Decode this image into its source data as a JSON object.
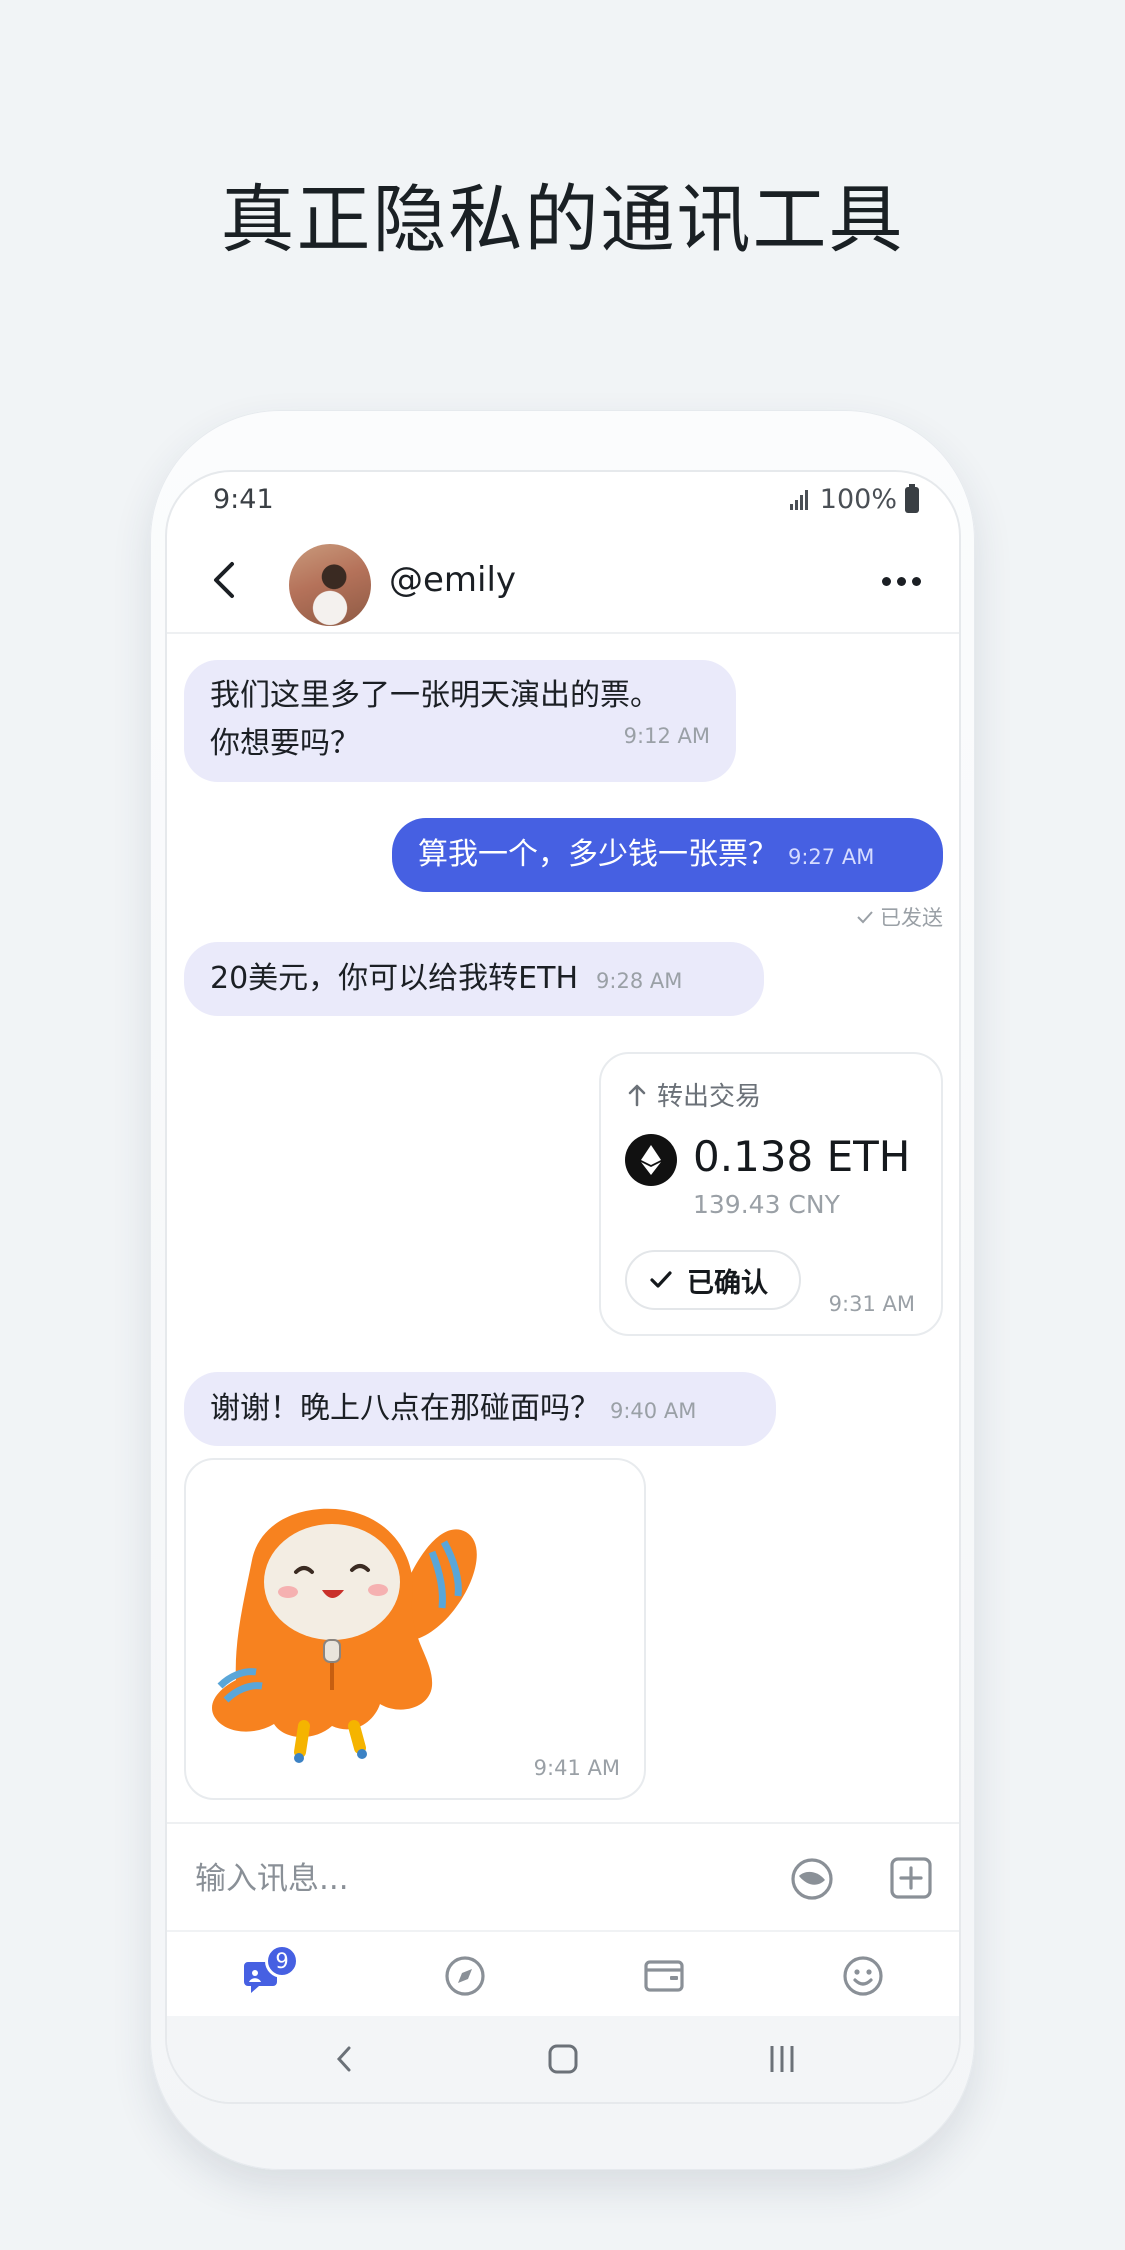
{
  "page": {
    "headline": "真正隐私的通讯工具"
  },
  "status_bar": {
    "time": "9:41",
    "battery": "100%"
  },
  "chat": {
    "contact": "@emily",
    "messages": [
      {
        "direction": "incoming",
        "lines": [
          "我们这里多了一张明天演出的票。",
          "你想要吗？"
        ],
        "time": "9:12 AM"
      },
      {
        "direction": "outgoing",
        "text": "算我一个，多少钱一张票？",
        "time": "9:27 AM",
        "status": "已发送"
      },
      {
        "direction": "incoming",
        "text": "20美元，你可以给我转ETH",
        "time": "9:28 AM"
      },
      {
        "direction": "outgoing",
        "type": "transaction",
        "label": "转出交易",
        "amount": "0.138 ETH",
        "fiat": "139.43 CNY",
        "state": "已确认",
        "time": "9:31 AM"
      },
      {
        "direction": "incoming",
        "text": "谢谢！晚上八点在那碰面吗？",
        "time": "9:40 AM"
      },
      {
        "direction": "incoming",
        "type": "sticker",
        "sticker": "orange-hooded-mascot-waving",
        "time": "9:41 AM"
      }
    ]
  },
  "composer": {
    "placeholder": "输入讯息..."
  },
  "tabbar": {
    "tabs": [
      {
        "icon": "chat-icon",
        "badge": "9",
        "active": true
      },
      {
        "icon": "compass-icon"
      },
      {
        "icon": "wallet-icon"
      },
      {
        "icon": "smiley-icon"
      }
    ]
  },
  "colors": {
    "accent": "#4660e2",
    "incoming_bubble": "#eaeafa",
    "background": "#f1f4f6"
  }
}
